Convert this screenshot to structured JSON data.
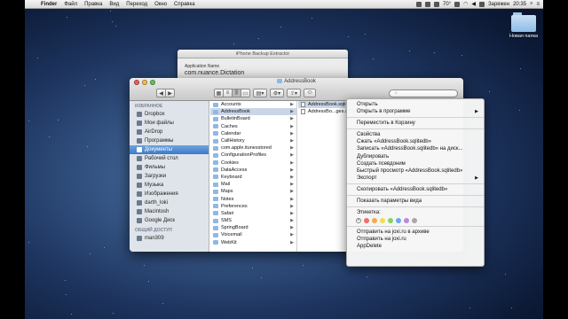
{
  "menubar": {
    "app": "Finder",
    "items": [
      "Файл",
      "Правка",
      "Вид",
      "Переход",
      "Окно",
      "Справка"
    ],
    "battery": "Заряжен",
    "time": "20:35",
    "temp": "70°"
  },
  "desktop": {
    "folder_label": "Новая папка"
  },
  "background_window": {
    "title": "iPhone Backup Extractor",
    "field_label": "Application Name",
    "field_value": "com.nuance.Dictation"
  },
  "finder": {
    "title": "AddressBook",
    "search_placeholder": "",
    "sidebar": {
      "favorites_header": "ИЗБРАННОЕ",
      "favorites": [
        "Dropbox",
        "Мои файлы",
        "AirDrop",
        "Программы",
        "Документы",
        "Рабочий стол",
        "Фильмы",
        "Загрузки",
        "Музыка",
        "Изображения",
        "darth_loki",
        "Macintosh",
        "Google Диск"
      ],
      "selected_index": 4,
      "shared_header": "ОБЩИЙ ДОСТУП",
      "shared": [
        "man309"
      ]
    },
    "column1": {
      "items": [
        "Accounts",
        "AddressBook",
        "BulletinBoard",
        "Caches",
        "Calendar",
        "CallHistory",
        "com.apple.itunesstored",
        "ConfigurationProfiles",
        "Cookies",
        "DataAccess",
        "Keyboard",
        "Mail",
        "Maps",
        "Notes",
        "Preferences",
        "Safari",
        "SMS",
        "SpringBoard",
        "Voicemail",
        "WebKit"
      ],
      "selected_index": 1
    },
    "column2": {
      "items": [
        "AddressBook.sqlitedb",
        "AddressBo...ges.sqlitedb"
      ],
      "selected_index": 0
    }
  },
  "context_menu": {
    "group1": [
      {
        "label": "Открыть",
        "submenu": false
      },
      {
        "label": "Открыть в программе",
        "submenu": true
      }
    ],
    "group2": [
      {
        "label": "Переместить в Корзину",
        "submenu": false
      }
    ],
    "group3": [
      {
        "label": "Свойства",
        "submenu": false
      },
      {
        "label": "Сжать «AddressBook.sqlitedb»",
        "submenu": false
      },
      {
        "label": "Записать «AddressBook.sqlitedb» на диск...",
        "submenu": false
      },
      {
        "label": "Дублировать",
        "submenu": false
      },
      {
        "label": "Создать псевдоним",
        "submenu": false
      },
      {
        "label": "Быстрый просмотр «AddressBook.sqlitedb»",
        "submenu": false
      },
      {
        "label": "Экспорт",
        "submenu": true
      }
    ],
    "group4": [
      {
        "label": "Скопировать «AddressBook.sqlitedb»",
        "submenu": false
      }
    ],
    "group5": [
      {
        "label": "Показать параметры вида",
        "submenu": false
      }
    ],
    "tags_label": "Этикетка:",
    "tag_colors": [
      "#f26d6d",
      "#f4a94d",
      "#f3dc55",
      "#86d160",
      "#6aa8f0",
      "#b78ae0",
      "#a8a8a8"
    ],
    "group6": [
      {
        "label": "Отправить на joxi.ru в архиве",
        "submenu": false
      },
      {
        "label": "Отправить на joxi.ru",
        "submenu": false
      },
      {
        "label": "AppDelete",
        "submenu": false
      }
    ]
  }
}
